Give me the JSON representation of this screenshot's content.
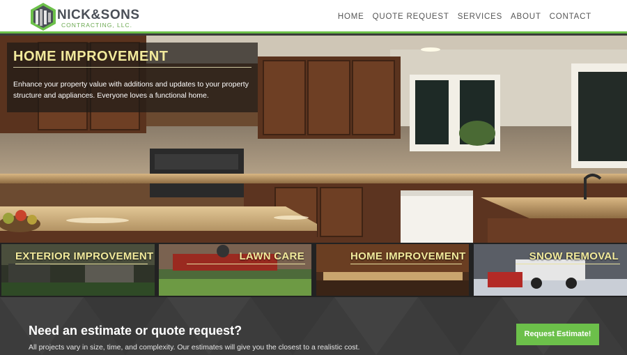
{
  "header": {
    "logo": {
      "brand": "NICK&SONS",
      "sub": "CONTRACTING, LLC."
    },
    "nav": [
      "HOME",
      "QUOTE REQUEST",
      "SERVICES",
      "ABOUT",
      "CONTACT"
    ]
  },
  "hero": {
    "title": "HOME IMPROVEMENT",
    "text": "Enhance your property value with additions and updates to your property structure and appliances. Everyone loves a functional home."
  },
  "tiles": [
    {
      "label": "EXTERIOR IMPROVEMENT"
    },
    {
      "label": "LAWN CARE"
    },
    {
      "label": "HOME IMPROVEMENT"
    },
    {
      "label": "SNOW REMOVAL"
    }
  ],
  "cta": {
    "title": "Need an estimate or quote request?",
    "text": "All projects vary in size, time, and complexity. Our estimates will give you the closest to a realistic cost.",
    "button": "Request Estimate!"
  },
  "colors": {
    "accent": "#6cc04a",
    "title_yellow": "#f2ea9c",
    "nav_text": "#555555"
  }
}
